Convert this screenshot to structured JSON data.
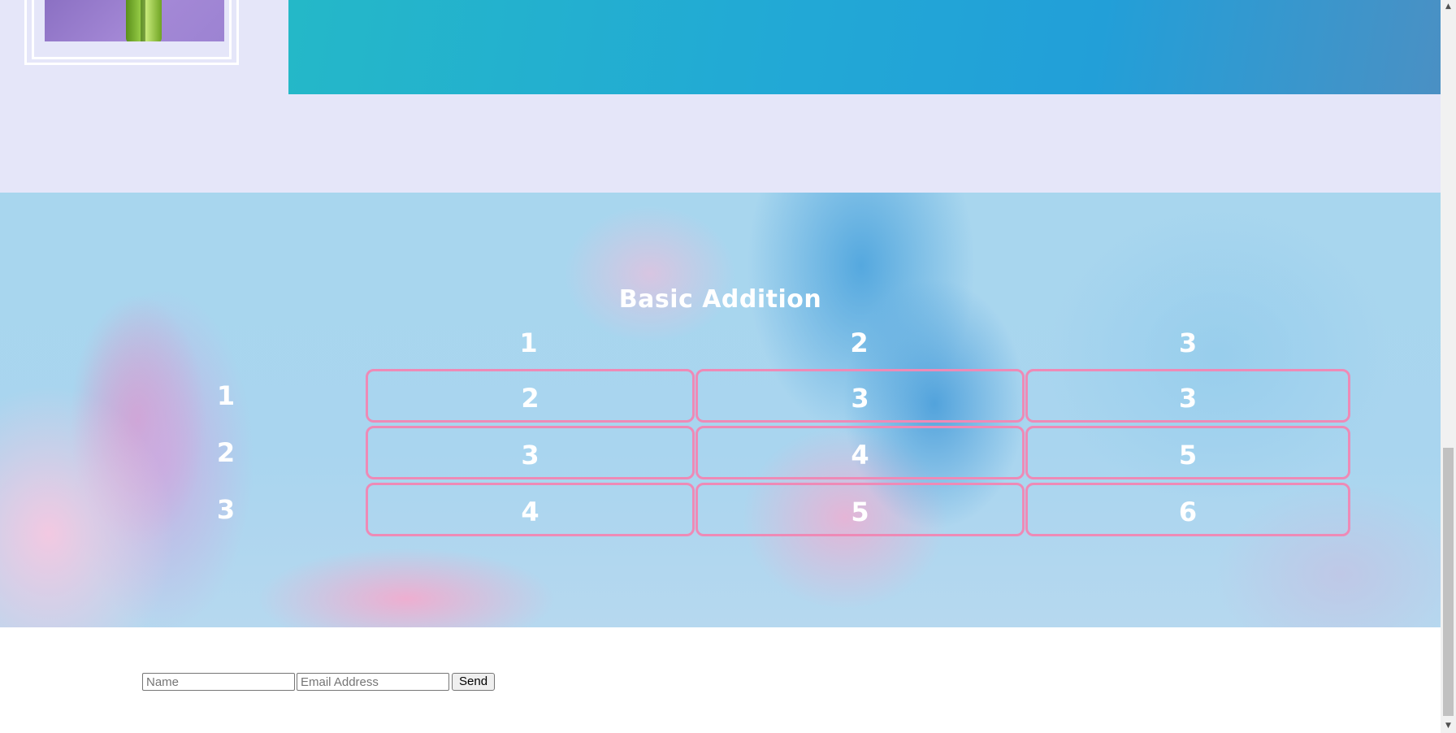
{
  "section": {
    "title": "Basic Addition"
  },
  "addition_table": {
    "column_headers": [
      "1",
      "2",
      "3"
    ],
    "rows": [
      {
        "label": "1",
        "cells": [
          "2",
          "3",
          "3"
        ]
      },
      {
        "label": "2",
        "cells": [
          "3",
          "4",
          "5"
        ]
      },
      {
        "label": "3",
        "cells": [
          "4",
          "5",
          "6"
        ]
      }
    ],
    "cell_border_color": "#ee8ab6"
  },
  "form": {
    "name_placeholder": "Name",
    "email_placeholder": "Email Address",
    "send_label": "Send"
  },
  "colors": {
    "top_band": "#e5e6f9",
    "hero_gradient_start": "#24b8c8",
    "hero_gradient_end": "#4a90c4"
  },
  "icons": {
    "scroll_up": "triangle-up-icon",
    "scroll_down": "triangle-down-icon"
  }
}
